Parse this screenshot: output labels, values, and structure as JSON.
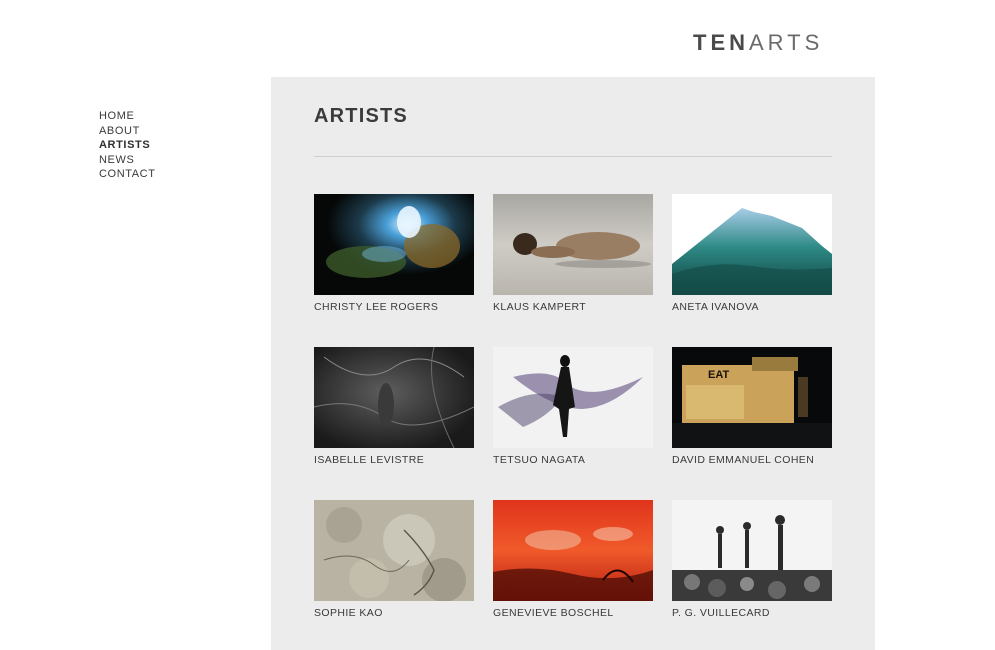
{
  "header": {
    "logo_bold": "TEN",
    "logo_light": "ARTS"
  },
  "nav": {
    "items": [
      {
        "label": "HOME",
        "active": false
      },
      {
        "label": "ABOUT",
        "active": false
      },
      {
        "label": "ARTISTS",
        "active": true
      },
      {
        "label": "NEWS",
        "active": false
      },
      {
        "label": "CONTACT",
        "active": false
      }
    ]
  },
  "main": {
    "title": "ARTISTS",
    "artists": [
      {
        "name": "CHRISTY LEE ROGERS"
      },
      {
        "name": "KLAUS KAMPERT"
      },
      {
        "name": "ANETA IVANOVA"
      },
      {
        "name": "ISABELLE LEVISTRE"
      },
      {
        "name": "TETSUO NAGATA"
      },
      {
        "name": "DAVID EMMANUEL COHEN"
      },
      {
        "name": "SOPHIE KAO"
      },
      {
        "name": "GENEVIEVE BOSCHEL"
      },
      {
        "name": "P. G. VUILLECARD"
      }
    ],
    "thumb_sign_text": "EAT"
  },
  "colors": {
    "panel_background": "#ececec",
    "text": "#3a3a3a"
  }
}
